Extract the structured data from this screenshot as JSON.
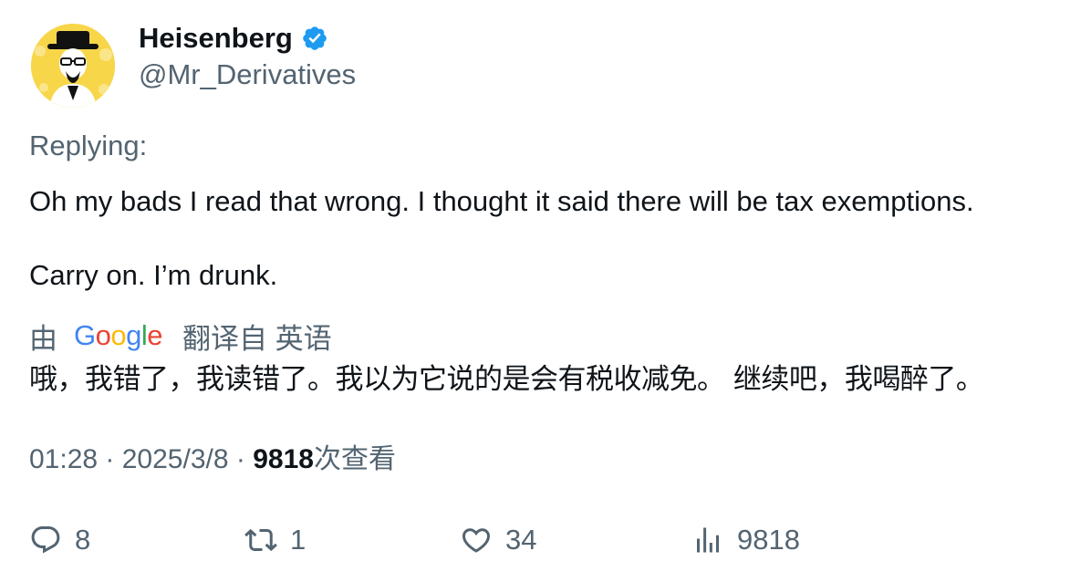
{
  "author": {
    "display_name": "Heisenberg",
    "handle": "@Mr_Derivatives",
    "verified": true,
    "verified_color": "#1d9bf0",
    "avatar_icon": "heisenberg-avatar"
  },
  "tweet": {
    "replying_label": "Replying:",
    "line1": "Oh my bads I read that wrong. I thought it said there will be tax exemptions.",
    "line2": "Carry on. I’m drunk."
  },
  "translation": {
    "by_label": "由",
    "provider": "Google",
    "source_label": "翻译自 英语",
    "text": "哦，我错了，我读错了。我以为它说的是会有税收减免。 继续吧，我喝醉了。"
  },
  "meta": {
    "time": "01:28",
    "separator": " · ",
    "date": "2025/3/8",
    "views_count": "9818",
    "views_label": "次查看"
  },
  "actions": {
    "replies": "8",
    "retweets": "1",
    "likes": "34",
    "views": "9818"
  },
  "colors": {
    "text_primary": "#0f1419",
    "text_secondary": "#536471",
    "avatar_bg": "#f7d64a"
  }
}
